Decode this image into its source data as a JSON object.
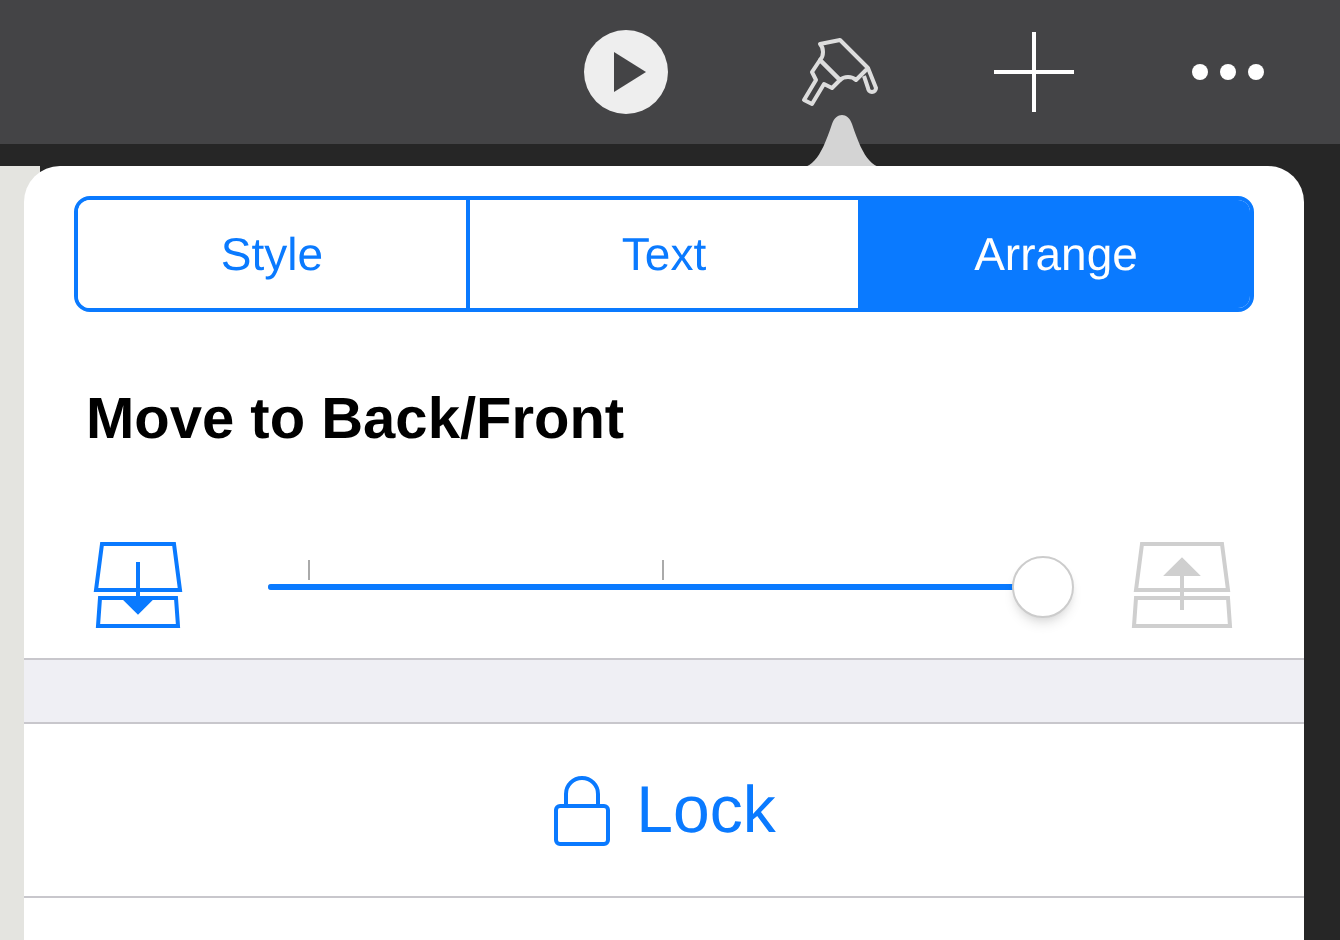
{
  "toolbar": {
    "buttons": [
      {
        "kind": "play"
      },
      {
        "kind": "brush"
      },
      {
        "kind": "add"
      },
      {
        "kind": "more"
      }
    ]
  },
  "tabs": [
    {
      "label": "Style",
      "selected": false
    },
    {
      "label": "Text",
      "selected": false
    },
    {
      "label": "Arrange",
      "selected": true
    }
  ],
  "arrange": {
    "title": "Move to Back/Front",
    "send_to_back": {
      "disabled": false
    },
    "bring_to_front": {
      "disabled": true
    },
    "slider": {
      "level": 1
    }
  },
  "lock_button": {
    "label": "Lock"
  }
}
